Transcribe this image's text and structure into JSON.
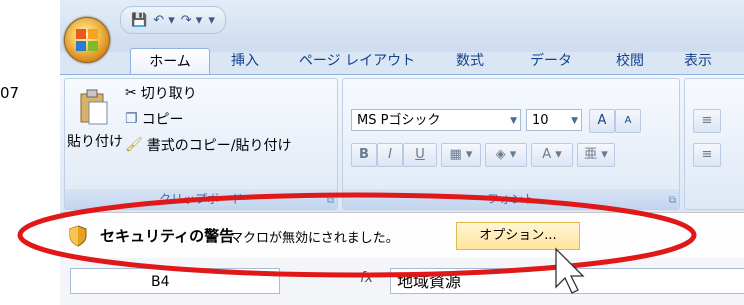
{
  "side_text": "07",
  "quick_access": {
    "save": "💾",
    "undo": "↶ ▾",
    "redo": "↷ ▾",
    "more": "▾"
  },
  "tabs": [
    "ホーム",
    "挿入",
    "ページ レイアウト",
    "数式",
    "データ",
    "校閲",
    "表示"
  ],
  "clipboard": {
    "paste": "貼り付け",
    "cut": "切り取り",
    "copy": "コピー",
    "format_painter": "書式のコピー/貼り付け",
    "label": "クリップボード"
  },
  "font": {
    "name": "MS Pゴシック",
    "size": "10",
    "grow": "A",
    "shrink": "A",
    "bold": "B",
    "italic": "I",
    "underline": "U",
    "label": "フォント"
  },
  "security": {
    "title": "セキュリティの警告",
    "message": "マクロが無効にされました。",
    "options_button": "オプション..."
  },
  "formula": {
    "namebox": "B4",
    "fx": "fx",
    "content": "地域資源"
  },
  "colors": {
    "annotation": "#e01818",
    "accent": "#15428b"
  }
}
